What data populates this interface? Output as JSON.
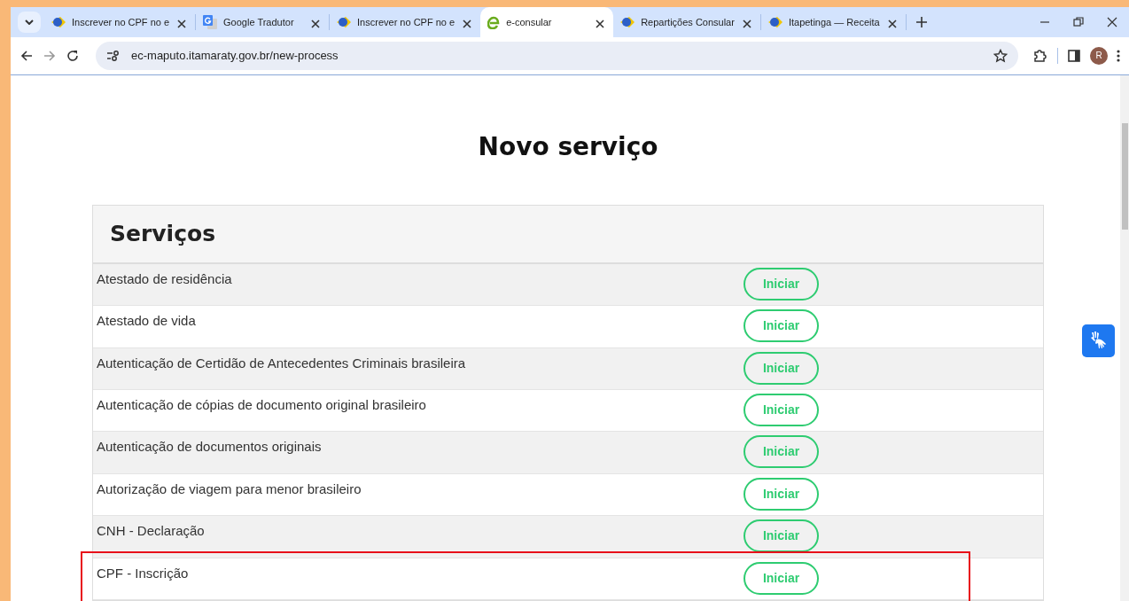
{
  "browser": {
    "tabs": [
      {
        "title": "Inscrever no CPF no e",
        "kind": "gov",
        "selected": false
      },
      {
        "title": "Google Tradutor",
        "kind": "translate",
        "selected": false
      },
      {
        "title": "Inscrever no CPF no e",
        "kind": "gov",
        "selected": false
      },
      {
        "title": "e-consular",
        "kind": "e",
        "selected": true
      },
      {
        "title": "Repartições Consular",
        "kind": "gov",
        "selected": false
      },
      {
        "title": "Itapetinga — Receita",
        "kind": "gov",
        "selected": false
      }
    ],
    "url": "ec-maputo.itamaraty.gov.br/new-process",
    "profile_initial": "R"
  },
  "page": {
    "title": "Novo serviço",
    "card_title": "Serviços",
    "services": [
      {
        "name": "Atestado de residência",
        "button": "Iniciar",
        "highlighted": false
      },
      {
        "name": "Atestado de vida",
        "button": "Iniciar",
        "highlighted": false
      },
      {
        "name": "Autenticação de Certidão de Antecedentes Criminais brasileira",
        "button": "Iniciar",
        "highlighted": false
      },
      {
        "name": "Autenticação de cópias de documento original brasileiro",
        "button": "Iniciar",
        "highlighted": false
      },
      {
        "name": "Autenticação de documentos originais",
        "button": "Iniciar",
        "highlighted": false
      },
      {
        "name": "Autorização de viagem para menor brasileiro",
        "button": "Iniciar",
        "highlighted": false
      },
      {
        "name": "CNH - Declaração",
        "button": "Iniciar",
        "highlighted": false
      },
      {
        "name": "CPF - Inscrição",
        "button": "Iniciar",
        "highlighted": true
      }
    ]
  }
}
